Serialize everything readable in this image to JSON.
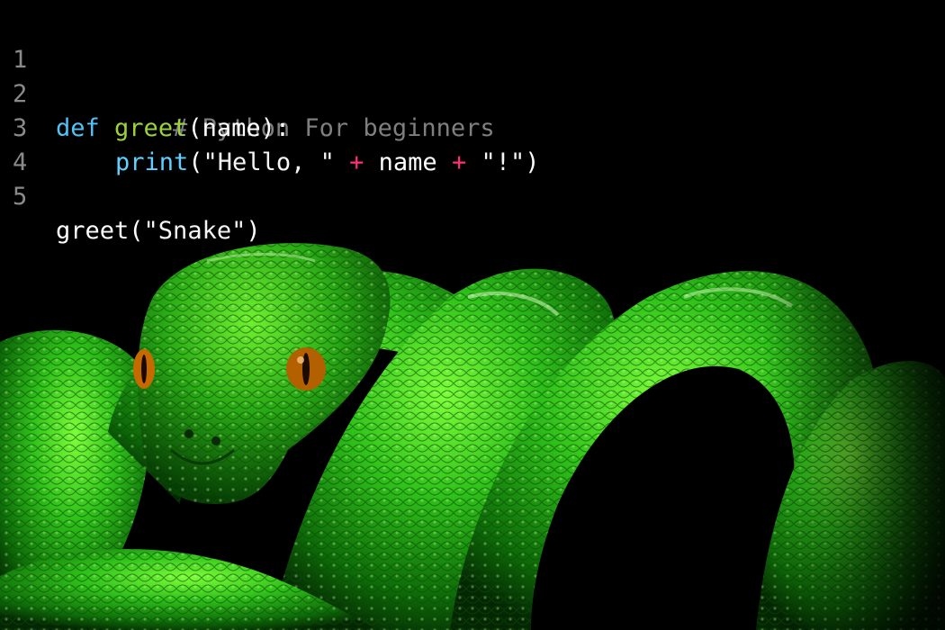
{
  "code": {
    "lines": [
      {
        "number": "1",
        "comment": "# Python For beginners"
      },
      {
        "number": "2",
        "keyword": "def",
        "func": "greet",
        "open": "(",
        "param": "name",
        "close": "):"
      },
      {
        "number": "3",
        "builtin": "print",
        "open": "(",
        "str1": "\"Hello, \"",
        "op1": "+",
        "var": "name",
        "op2": "+",
        "str2": "\"!\"",
        "close": ")"
      },
      {
        "number": "4"
      },
      {
        "number": "5",
        "call": "greet",
        "open": "(",
        "arg": "\"Snake\"",
        "close": ")"
      }
    ]
  },
  "colors": {
    "background": "#000000",
    "line_number": "#8a8a8a",
    "comment": "#7f7f7f",
    "keyword": "#4fc3f7",
    "function_name": "#9bd43a",
    "builtin": "#5fd0ff",
    "operator": "#ff2f7a",
    "snake_green": "#2fbf1a"
  },
  "image": {
    "subject": "green tree python coiled on a branch",
    "icon": "snake-illustration"
  }
}
